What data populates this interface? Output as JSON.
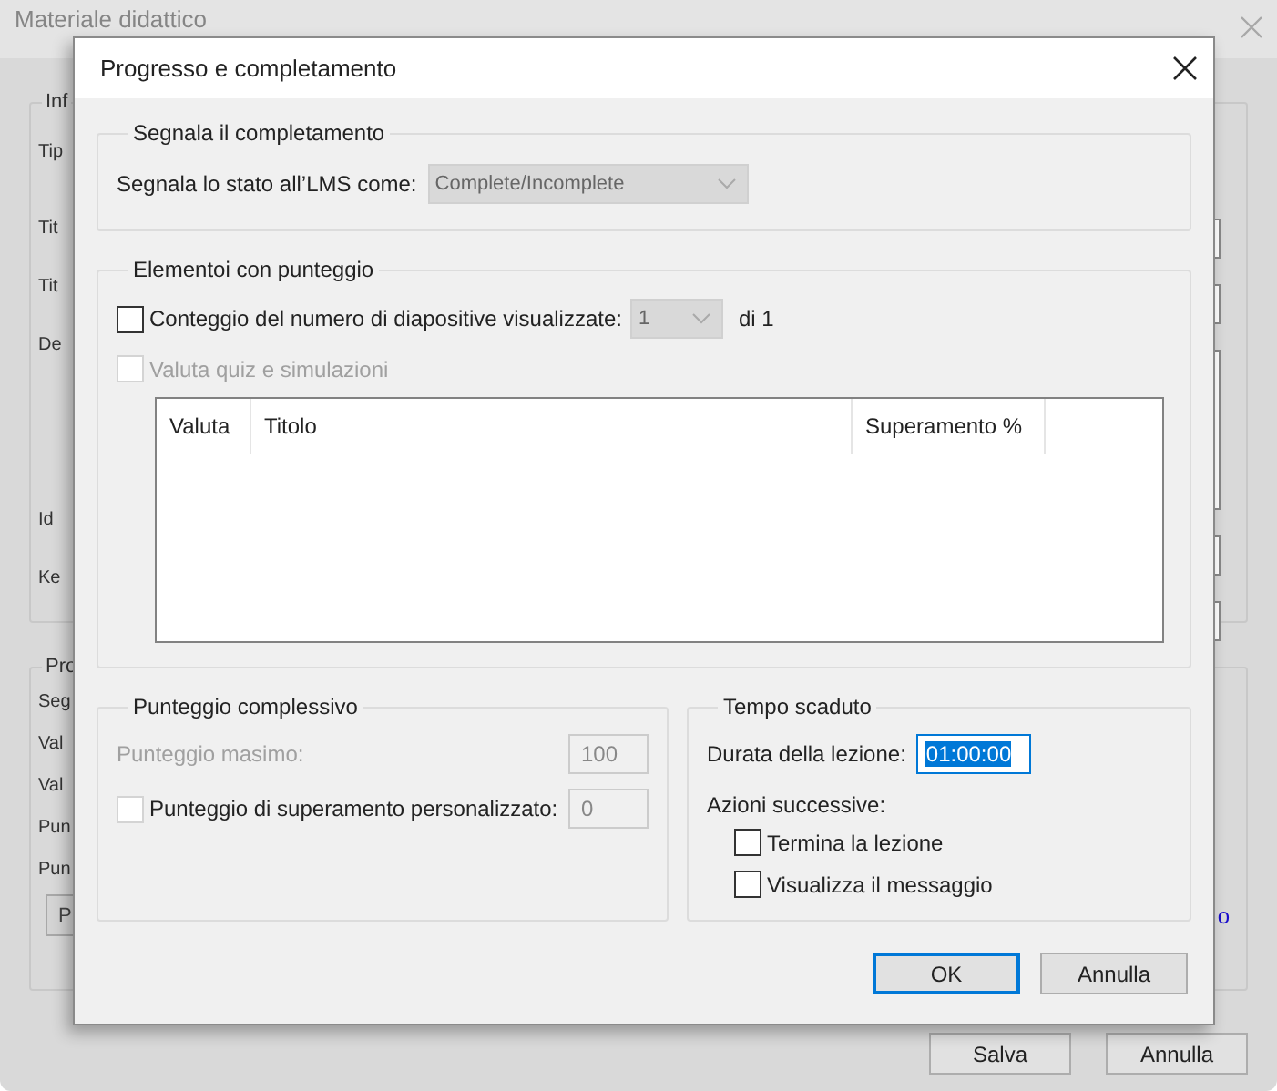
{
  "background_window": {
    "title": "Materiale didattico",
    "groups": [
      {
        "legend": "Inf",
        "labels": [
          "Tip",
          "Tit",
          "Tit",
          "De",
          "Id",
          "Ke"
        ]
      },
      {
        "legend": "Pro",
        "labels": [
          "Seg",
          "Val",
          "Val",
          "Pun",
          "Pun"
        ],
        "button": "P",
        "link": "o"
      }
    ],
    "buttons": [
      "Salva",
      "Annulla"
    ]
  },
  "dialog": {
    "title": "Progresso e completamento",
    "completion": {
      "legend": "Segnala il completamento",
      "label": "Segnala lo stato all’LMS come:",
      "value": "Complete/Incomplete",
      "disabled": true
    },
    "scoring": {
      "legend": "Elementoi con punteggio",
      "slide_count": {
        "label": "Conteggio del numero di diapositive visualizzate:",
        "checked": false,
        "value": "1",
        "suffix": "di 1"
      },
      "quiz": {
        "label": "Valuta quiz e simulazioni",
        "checked": false,
        "disabled": true
      },
      "table": {
        "columns": [
          "Valuta",
          "Titolo",
          "Superamento %"
        ]
      }
    },
    "total_score": {
      "legend": "Punteggio complessivo",
      "max": {
        "label": "Punteggio masimo:",
        "value": "100",
        "disabled": true
      },
      "pass": {
        "label": "Punteggio di superamento personalizzato:",
        "value": "0",
        "checked": false,
        "disabled": true
      }
    },
    "timeout": {
      "legend": "Tempo scaduto",
      "duration": {
        "label": "Durata della lezione:",
        "value": "01:00:00",
        "selected": true
      },
      "actions_label": "Azioni successive:",
      "actions": [
        {
          "label": "Termina la lezione",
          "checked": false
        },
        {
          "label": "Visualizza il messaggio",
          "checked": false
        }
      ]
    },
    "buttons": [
      {
        "label": "OK",
        "default": true
      },
      {
        "label": "Annulla",
        "default": false
      }
    ]
  }
}
